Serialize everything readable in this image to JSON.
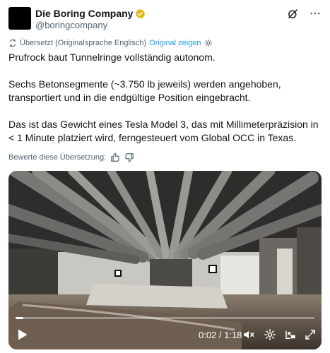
{
  "author": {
    "name": "Die Boring Company",
    "handle": "@boringcompany"
  },
  "translation": {
    "label": "Übersetzt (Originalsprache Englisch)",
    "show_original": "Original zeigen"
  },
  "tweet": {
    "paragraphs": [
      "Prufrock baut Tunnelringe vollständig autonom.",
      "Sechs Betonsegmente (~3.750 lb jeweils) werden angehoben, transportiert und in die endgültige Position eingebracht.",
      "Das ist das Gewicht eines Tesla Model 3, das mit Millimeterpräzision in < 1 Minute platziert wird, ferngesteuert vom Global OCC in Texas."
    ]
  },
  "rating": {
    "label": "Bewerte diese Übersetzung:"
  },
  "video": {
    "timecode": "0:02 / 1:18",
    "progress": 0.026
  },
  "colors": {
    "link": "#1d9bf0",
    "secondary_text": "#536471",
    "verified_badge": "#e2b719"
  },
  "icons": {
    "verified": "gold-verified-badge-icon",
    "grok": "grok-icon",
    "more": "more-options-icon",
    "translate": "translate-icon",
    "settings": "settings-gear-icon",
    "thumbs_up": "thumbs-up-icon",
    "thumbs_down": "thumbs-down-icon",
    "play": "play-icon",
    "video_settings": "gear-icon",
    "pip": "picture-in-picture-icon",
    "fullscreen": "fullscreen-icon"
  }
}
